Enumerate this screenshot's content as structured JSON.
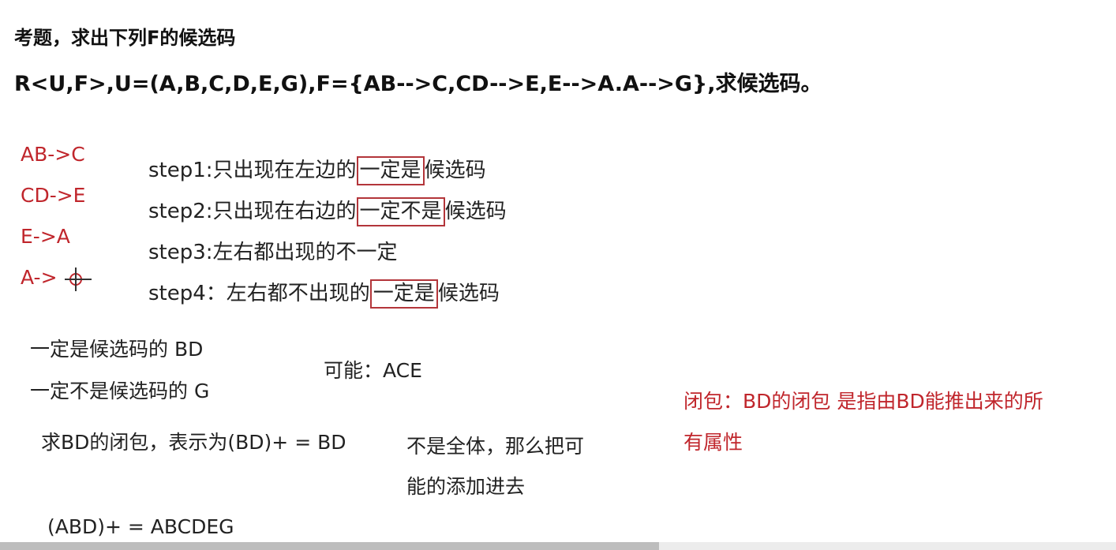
{
  "title": "考题，求出下列F的候选码",
  "relation": "R<U,F>,U=(A,B,C,D,E,G),F={AB-->C,CD-->E,E-->A.A-->G},求候选码。",
  "fds": [
    "AB->C",
    "CD->E",
    "E->A",
    "A->"
  ],
  "steps": [
    {
      "prefix": "step1:只出现在左边的",
      "boxed": "一定是",
      "suffix": "候选码"
    },
    {
      "prefix": "step2:只出现在右边的",
      "boxed": "一定不是",
      "suffix": "候选码"
    },
    {
      "prefix": "step3:左右都出现的不一定",
      "boxed": "",
      "suffix": ""
    },
    {
      "prefix": "step4：左右都不出现的",
      "boxed": "一定是",
      "suffix": "候选码"
    }
  ],
  "result": {
    "must_be": "一定是候选码的 BD",
    "must_not_be": "一定不是候选码的 G",
    "possible": "可能：ACE"
  },
  "closure": {
    "bd_closure": "求BD的闭包，表示为(BD)+ = BD",
    "not_all_line1": "不是全体，那么把可",
    "not_all_line2": "能的添加进去",
    "abd_closure": "(ABD)+ =   ABCDEG"
  },
  "note": {
    "line1": "闭包：BD的闭包 是指由BD能推出来的所",
    "line2": "有属性"
  },
  "colors": {
    "annotation_red": "#c0262c",
    "box_border": "#b3353a"
  },
  "icons": {
    "cursor": "crosshair-cursor-icon"
  }
}
